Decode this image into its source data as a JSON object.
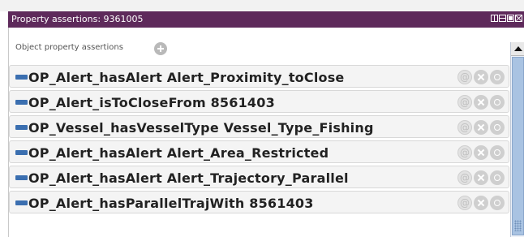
{
  "window": {
    "title": "Property assertions: 9361005"
  },
  "section": {
    "label": "Object property assertions",
    "add_icon": "add-circle-icon"
  },
  "assertions": [
    {
      "text": "OP_Alert_hasAlert  Alert_Proximity_toClose"
    },
    {
      "text": "OP_Alert_isToCloseFrom  8561403"
    },
    {
      "text": "OP_Vessel_hasVesselType  Vessel_Type_Fishing"
    },
    {
      "text": "OP_Alert_hasAlert  Alert_Area_Restricted"
    },
    {
      "text": "OP_Alert_hasAlert  Alert_Trajectory_Parallel"
    },
    {
      "text": "OP_Alert_hasParallelTrajWith  8561403"
    }
  ],
  "row_actions": {
    "annotate_label": "@",
    "icons": [
      "annotate-icon",
      "delete-icon",
      "edit-icon"
    ]
  },
  "colors": {
    "titlebar": "#5e2a5b",
    "marker": "#3b6fb0",
    "scroll_thumb": "#a9c3e2"
  }
}
